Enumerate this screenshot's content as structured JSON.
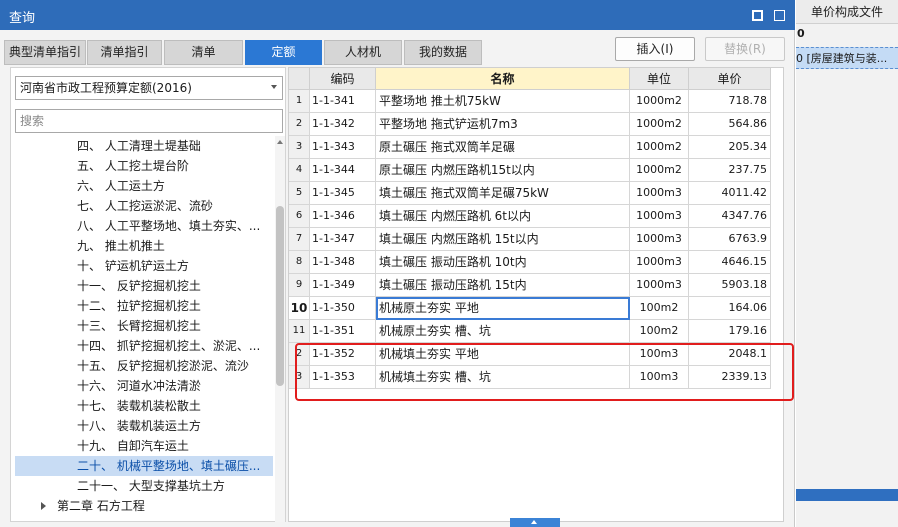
{
  "window": {
    "title": "查询"
  },
  "tabs": [
    {
      "label": "典型清单指引",
      "active": false
    },
    {
      "label": "清单指引",
      "active": false
    },
    {
      "label": "清单",
      "active": false
    },
    {
      "label": "定额",
      "active": true
    },
    {
      "label": "人材机",
      "active": false
    },
    {
      "label": "我的数据",
      "active": false
    }
  ],
  "buttons": {
    "insert": "插入(I)",
    "replace": "替换(R)"
  },
  "left_panel": {
    "library": "河南省市政工程预算定额(2016)",
    "search_placeholder": "搜索",
    "tree": [
      {
        "label": "四、 人工清理土堤基础"
      },
      {
        "label": "五、 人工挖土堤台阶"
      },
      {
        "label": "六、 人工运土方"
      },
      {
        "label": "七、 人工挖运淤泥、流砂"
      },
      {
        "label": "八、 人工平整场地、填土夯实、..."
      },
      {
        "label": "九、 推土机推土"
      },
      {
        "label": "十、 铲运机铲运土方"
      },
      {
        "label": "十一、 反铲挖掘机挖土"
      },
      {
        "label": "十二、 拉铲挖掘机挖土"
      },
      {
        "label": "十三、 长臂挖掘机挖土"
      },
      {
        "label": "十四、 抓铲挖掘机挖土、淤泥、..."
      },
      {
        "label": "十五、 反铲挖掘机挖淤泥、流沙"
      },
      {
        "label": "十六、 河道水冲法清淤"
      },
      {
        "label": "十七、 装载机装松散土"
      },
      {
        "label": "十八、 装载机装运土方"
      },
      {
        "label": "十九、 自卸汽车运土"
      },
      {
        "label": "二十、 机械平整场地、填土碾压...",
        "selected": true
      },
      {
        "label": "二十一、 大型支撑基坑土方"
      },
      {
        "label": "第二章 石方工程",
        "chapter": true
      }
    ]
  },
  "grid": {
    "headers": {
      "code": "编码",
      "name": "名称",
      "unit": "单位",
      "price": "单价"
    },
    "rows": [
      {
        "num": "1",
        "code": "1-1-341",
        "name": "平整场地 推土机75kW",
        "unit": "1000m2",
        "price": "718.78"
      },
      {
        "num": "2",
        "code": "1-1-342",
        "name": "平整场地 拖式铲运机7m3",
        "unit": "1000m2",
        "price": "564.86"
      },
      {
        "num": "3",
        "code": "1-1-343",
        "name": "原土碾压 拖式双筒羊足碾",
        "unit": "1000m2",
        "price": "205.34"
      },
      {
        "num": "4",
        "code": "1-1-344",
        "name": "原土碾压 内燃压路机15t以内",
        "unit": "1000m2",
        "price": "237.75"
      },
      {
        "num": "5",
        "code": "1-1-345",
        "name": "填土碾压 拖式双筒羊足碾75kW",
        "unit": "1000m3",
        "price": "4011.42"
      },
      {
        "num": "6",
        "code": "1-1-346",
        "name": "填土碾压 内燃压路机 6t以内",
        "unit": "1000m3",
        "price": "4347.76"
      },
      {
        "num": "7",
        "code": "1-1-347",
        "name": "填土碾压 内燃压路机 15t以内",
        "unit": "1000m3",
        "price": "6763.9"
      },
      {
        "num": "8",
        "code": "1-1-348",
        "name": "填土碾压 振动压路机 10t内",
        "unit": "1000m3",
        "price": "4646.15"
      },
      {
        "num": "9",
        "code": "1-1-349",
        "name": "填土碾压 振动压路机 15t内",
        "unit": "1000m3",
        "price": "5903.18"
      },
      {
        "num": "10",
        "code": "1-1-350",
        "name": "机械原土夯实 平地",
        "unit": "100m2",
        "price": "164.06",
        "current": true
      },
      {
        "num": "11",
        "code": "1-1-351",
        "name": "机械原土夯实 槽、坑",
        "unit": "100m2",
        "price": "179.16"
      },
      {
        "num": "2",
        "code": "1-1-352",
        "name": "机械填土夯实 平地",
        "unit": "100m3",
        "price": "2048.1"
      },
      {
        "num": "3",
        "code": "1-1-353",
        "name": "机械填土夯实 槽、坑",
        "unit": "100m3",
        "price": "2339.13"
      }
    ]
  },
  "background_window": {
    "header": "单价构成文件",
    "row0": "0",
    "row1": "0 [房屋建筑与装..."
  }
}
